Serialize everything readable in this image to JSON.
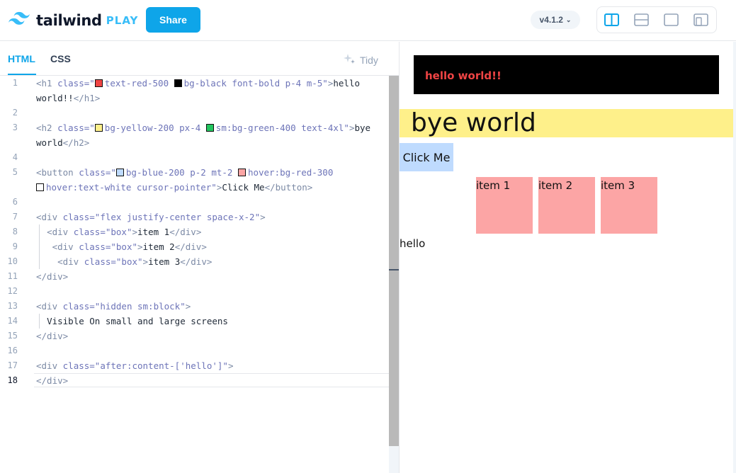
{
  "header": {
    "logo_word": "tailwind",
    "logo_play": "PLAY",
    "share_label": "Share",
    "version": "v4.1.2",
    "version_icon": "chevron-down-icon",
    "layout_icons": [
      "split-vertical-icon",
      "split-horizontal-icon",
      "preview-only-icon",
      "responsive-icon"
    ]
  },
  "editor": {
    "tabs": [
      {
        "label": "HTML"
      },
      {
        "label": "CSS"
      }
    ],
    "tidy_label": "Tidy",
    "line_numbers": [
      "1",
      "2",
      "3",
      "4",
      "5",
      "6",
      "7",
      "8",
      "9",
      "10",
      "11",
      "12",
      "13",
      "14",
      "15",
      "16",
      "17",
      "18"
    ],
    "swatch_colors": {
      "text-red-500": "#ef4444",
      "bg-black": "#000000",
      "bg-yellow-200": "#fef08a",
      "sm:bg-green-400": "#22c55e",
      "bg-blue-200": "#bfdbfe",
      "hover:bg-red-300": "#fca5a5",
      "hover:text-white": "#ffffff"
    }
  },
  "preview": {
    "h1_text": "hello world!!",
    "h2_text": "bye world",
    "button_text": "Click Me",
    "boxes": [
      "item 1",
      "item 2",
      "item 3"
    ],
    "after_text": "hello",
    "colors": {
      "h1_bg": "#000000",
      "h1_text": "#ef4444",
      "h2_bg": "#fef08a",
      "button_bg": "#bfdbfe",
      "box_bg": "#fca5a5"
    }
  }
}
